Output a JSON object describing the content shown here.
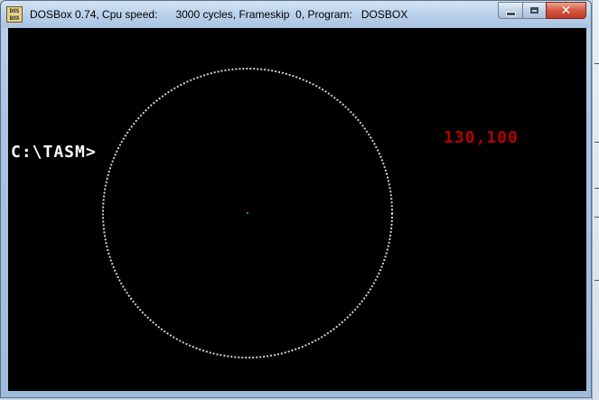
{
  "window": {
    "title_app": "DOSBox 0.74, Cpu speed:",
    "title_cycles": "3000 cycles, Frameskip  0, Program:",
    "title_program": "DOSBOX",
    "icon_text_top": "DOS",
    "icon_text_bottom": "BOX"
  },
  "controls": {
    "minimize": "minimize-icon",
    "maximize": "maximize-icon",
    "close_glyph": "✕"
  },
  "dos_screen": {
    "prompt": "C:\\TASM>",
    "coordinates": "130,100",
    "circle_color": "#d0d0d0",
    "center_dot_color": "#00a08a",
    "coordinates_color": "#b30000"
  }
}
